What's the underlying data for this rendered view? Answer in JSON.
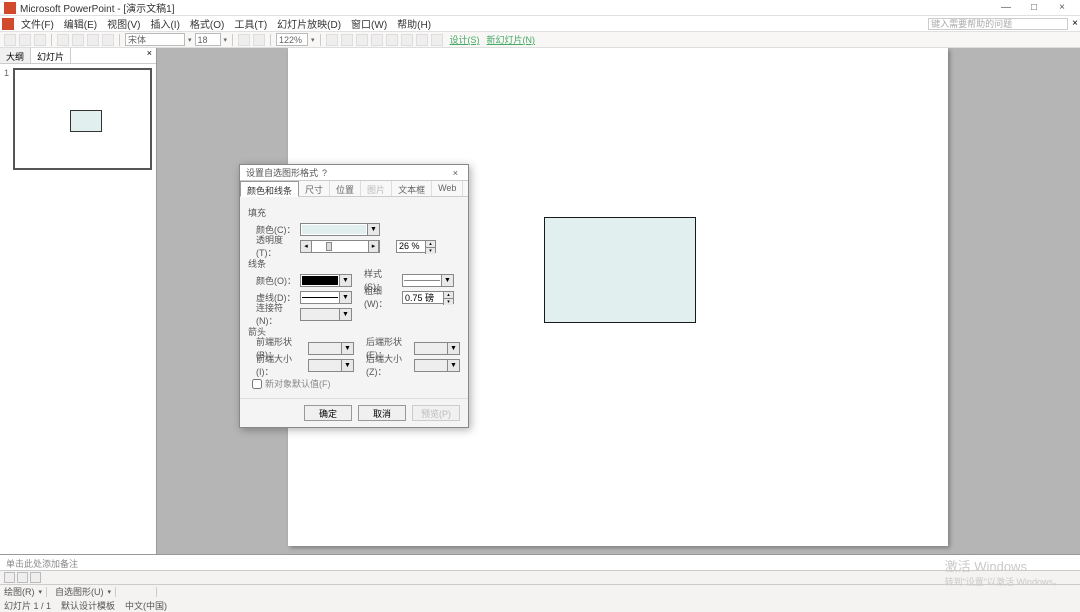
{
  "titlebar": {
    "app_name": "Microsoft PowerPoint - [演示文稿1]",
    "min": "—",
    "max": "□",
    "close": "×"
  },
  "menu": {
    "file": "文件(F)",
    "edit": "编辑(E)",
    "view": "视图(V)",
    "insert": "插入(I)",
    "format": "格式(O)",
    "tools": "工具(T)",
    "slideshow": "幻灯片放映(D)",
    "window": "窗口(W)",
    "help": "帮助(H)",
    "help_placeholder": "键入需要帮助的问题"
  },
  "toolbar": {
    "font": "宋体",
    "font_size": "18",
    "zoom": "122%",
    "design": "设计(S)",
    "new_slide": "新幻灯片(N)"
  },
  "sidebar": {
    "tab_outline": "大纲",
    "tab_slides": "幻灯片",
    "close": "×",
    "thumb_num": "1"
  },
  "dialog": {
    "title": "设置自选图形格式",
    "help": "?",
    "close": "×",
    "tabs": {
      "color_line": "颜色和线条",
      "size": "尺寸",
      "position": "位置",
      "picture": "图片",
      "textbox": "文本框",
      "web": "Web"
    },
    "sections": {
      "fill": "填充",
      "line": "线条",
      "arrow": "箭头"
    },
    "labels": {
      "color_c": "颜色(C)：",
      "transparency": "透明度(T)：",
      "color_o": "颜色(O)：",
      "dash": "虚线(D)：",
      "connector": "连接符(N)：",
      "style": "样式(S)：",
      "weight": "粗细(W)：",
      "begin_style": "前端形状(B)：",
      "begin_size": "前端大小(I)：",
      "end_style": "后端形状(E)：",
      "end_size": "后端大小(Z)："
    },
    "values": {
      "transparency": "26 %",
      "weight": "0.75 磅"
    },
    "colors": {
      "fill_swatch": "#e2efef",
      "line_swatch": "#000000"
    },
    "checkbox": "新对象默认值(F)",
    "buttons": {
      "ok": "确定",
      "cancel": "取消",
      "preview": "预览(P)"
    }
  },
  "notes": {
    "placeholder": "单击此处添加备注"
  },
  "statusbar": {
    "draw": "绘图(R)",
    "autoshape": "自选图形(U)",
    "slide_info": "幻灯片 1 / 1",
    "design_template": "默认设计模板",
    "language": "中文(中国)"
  },
  "watermark": {
    "line1": "激活 Windows",
    "line2": "转到\"设置\"以激活 Windows。"
  }
}
